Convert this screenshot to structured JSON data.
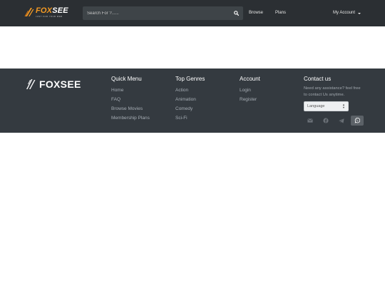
{
  "header": {
    "logo_name_prefix": "FOX",
    "logo_name_suffix": "SEE",
    "logo_tagline": "JUST FOR YOUR WEB",
    "search_placeholder": "Search For ?......",
    "nav": [
      {
        "label": "Browse"
      },
      {
        "label": "Plans"
      }
    ],
    "account_label": "My Account"
  },
  "footer": {
    "brand": "FOXSEE",
    "columns": [
      {
        "title": "Quick Menu",
        "links": [
          "Home",
          "FAQ",
          "Browse Movies",
          "Membership Plans"
        ]
      },
      {
        "title": "Top Genres",
        "links": [
          "Action",
          "Animation",
          "Comedy",
          "Sci-Fi"
        ]
      },
      {
        "title": "Account",
        "links": [
          "Login",
          "Register"
        ]
      }
    ],
    "contact": {
      "title": "Contact us",
      "text": "Need any assistance? feel free to contact Us anytime.",
      "language_value": "Language",
      "socials": [
        "email-icon",
        "facebook-icon",
        "telegram-icon",
        "whatsapp-icon"
      ]
    }
  },
  "colors": {
    "header_bg": "#2b2f33",
    "footer_bg": "#343a40",
    "brand_accent": "#f49a23"
  }
}
